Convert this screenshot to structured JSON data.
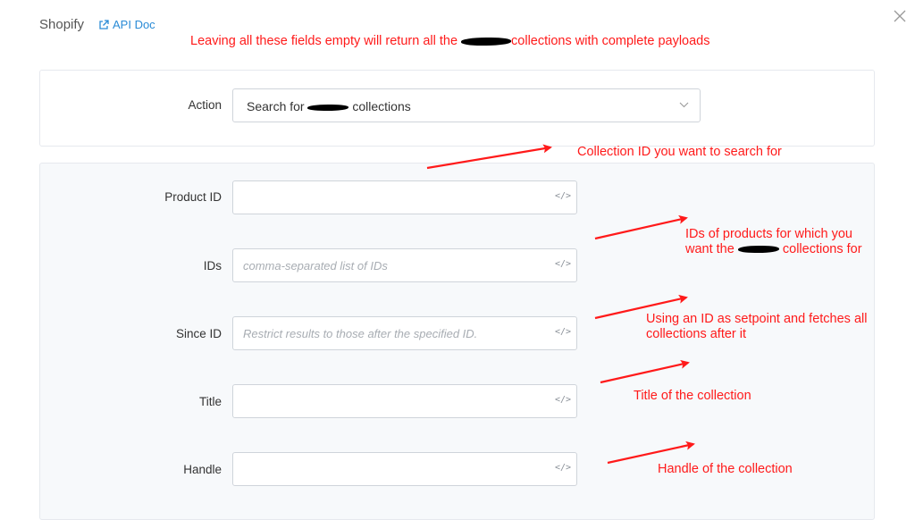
{
  "header": {
    "app_name": "Shopify",
    "api_doc_label": "API Doc"
  },
  "annotations": {
    "top_note_before": "Leaving all these fields empty will return all the",
    "top_note_after": "collections with complete payloads",
    "collection_id": "Collection ID you want to search for",
    "product_ids_line1": "IDs of products for which you",
    "product_ids_line2_before": "want the",
    "product_ids_line2_after": "collections for",
    "since_id_line1": "Using an ID as setpoint and fetches all",
    "since_id_line2": "collections after it",
    "title": "Title of the collection",
    "handle": "Handle of the collection"
  },
  "action": {
    "label": "Action",
    "value_before": "Search for",
    "value_after": "collections"
  },
  "fields": {
    "product_id": {
      "label": "Product ID",
      "value": "",
      "placeholder": ""
    },
    "ids": {
      "label": "IDs",
      "value": "",
      "placeholder": "comma-separated list of IDs"
    },
    "since_id": {
      "label": "Since ID",
      "value": "",
      "placeholder": "Restrict results to those after the specified ID."
    },
    "title": {
      "label": "Title",
      "value": "",
      "placeholder": ""
    },
    "handle": {
      "label": "Handle",
      "value": "",
      "placeholder": ""
    }
  },
  "code_icon_glyph": "</>",
  "colors": {
    "annotation_red": "#ff1a1a",
    "link_blue": "#2a8bd6",
    "panel_bg": "#f7f9fb"
  }
}
